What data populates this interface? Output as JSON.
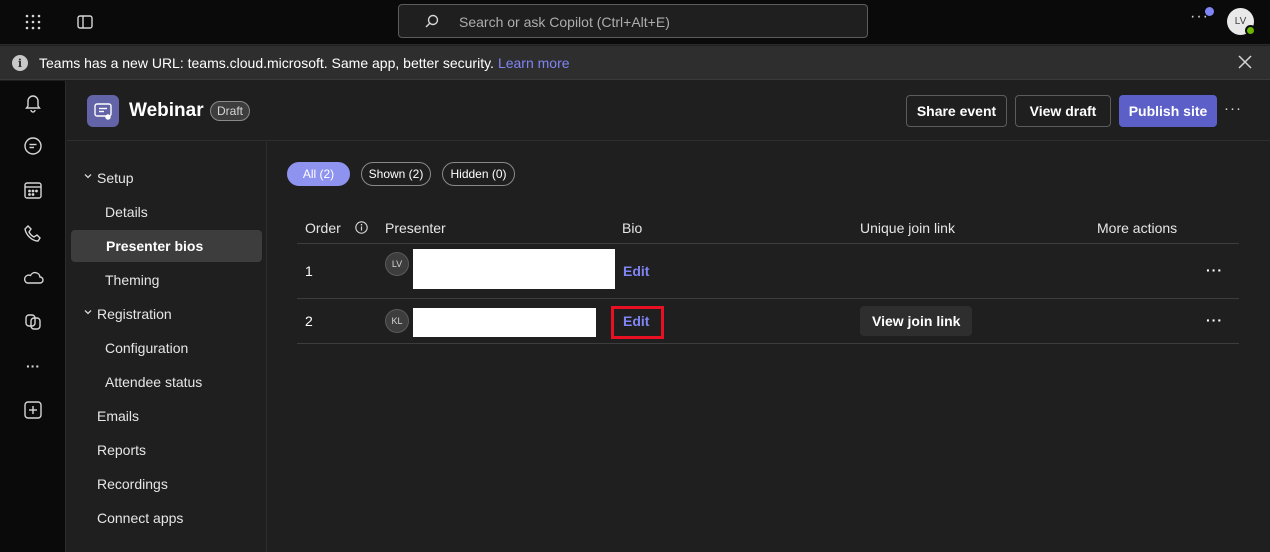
{
  "topbar": {
    "search_placeholder": "Search or ask Copilot (Ctrl+Alt+E)",
    "more_label": "···",
    "avatar_initials": "LV"
  },
  "banner": {
    "message": "Teams has a new URL: teams.cloud.microsoft. Same app, better security.",
    "link": "Learn more"
  },
  "rail": {
    "items": [
      "bell-icon",
      "chat-icon",
      "calendar-icon",
      "calls-icon",
      "onedrive-icon",
      "copilot-icon",
      "more-apps-icon",
      "add-apps-icon"
    ],
    "more_label": "···"
  },
  "header": {
    "title": "Webinar",
    "badge": "Draft",
    "share_label": "Share event",
    "view_draft_label": "View draft",
    "publish_label": "Publish site",
    "more_label": "···"
  },
  "nav": {
    "setup": "Setup",
    "details": "Details",
    "presenter_bios": "Presenter bios",
    "theming": "Theming",
    "registration": "Registration",
    "configuration": "Configuration",
    "attendee_status": "Attendee status",
    "emails": "Emails",
    "reports": "Reports",
    "recordings": "Recordings",
    "connect_apps": "Connect apps"
  },
  "filters": {
    "all": "All (2)",
    "shown": "Shown (2)",
    "hidden": "Hidden (0)"
  },
  "table": {
    "headers": {
      "order": "Order",
      "presenter": "Presenter",
      "bio": "Bio",
      "join_link": "Unique join link",
      "more_actions": "More actions"
    },
    "rows": [
      {
        "order": "1",
        "initials": "LV",
        "edit": "Edit",
        "more": "···"
      },
      {
        "order": "2",
        "initials": "KL",
        "edit": "Edit",
        "join_button": "View join link",
        "more": "···"
      }
    ]
  },
  "colors": {
    "accent": "#7f85f5",
    "primary_button": "#5b5fc7",
    "highlight": "#e81123",
    "background": "#1f1f1f"
  }
}
